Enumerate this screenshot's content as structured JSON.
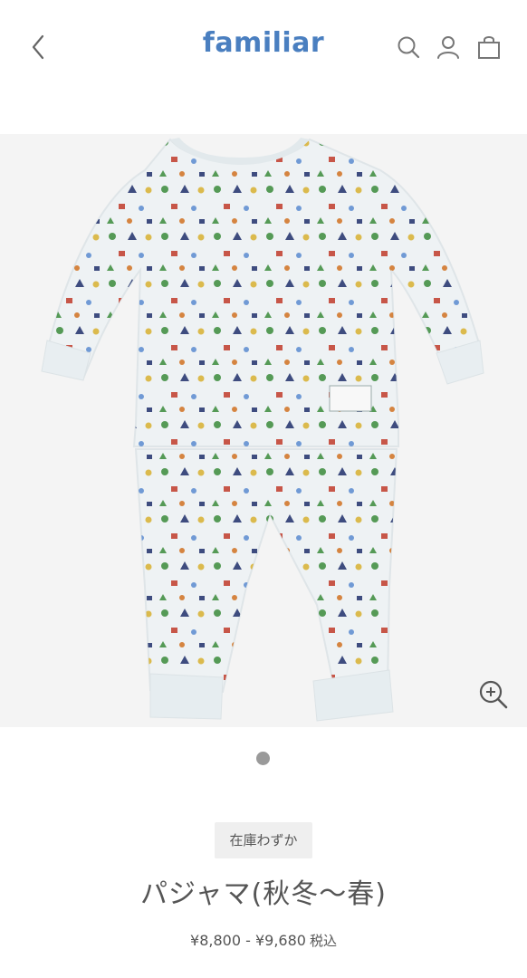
{
  "header": {
    "brand": "familiar",
    "icons": [
      "chevron-left-icon",
      "search-icon",
      "user-icon",
      "shopping-bag-icon"
    ]
  },
  "gallery": {
    "image_alt": "パジャマ(秋冬〜春)",
    "zoom_icon": "zoom-in-icon",
    "slide_current": 1,
    "slide_total": 1
  },
  "product": {
    "stock_badge": "在庫わずか",
    "title": "パジャマ(秋冬〜春)",
    "price": "¥8,800 - ¥9,680",
    "tax_label": "税込"
  },
  "colors": {
    "brand": "#4a7fc0",
    "text": "#555555",
    "image_bg": "#f4f4f4",
    "badge_bg": "#efefef",
    "dot": "#9a9a9a"
  }
}
